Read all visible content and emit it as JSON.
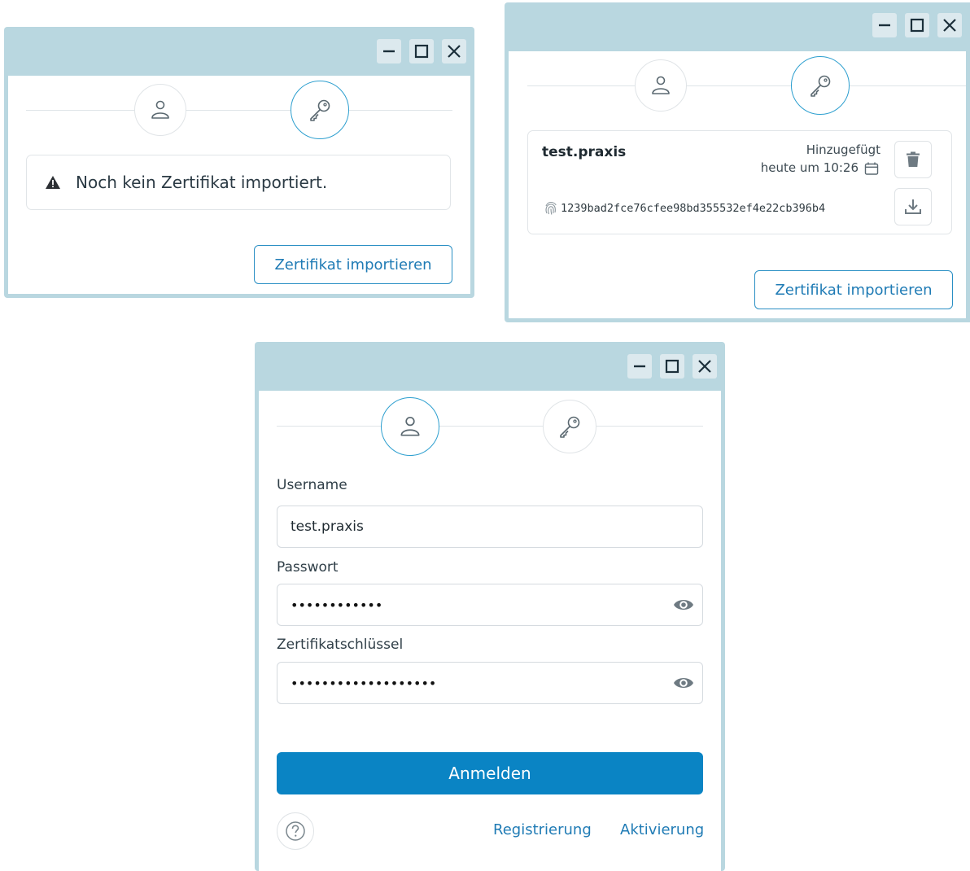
{
  "window_empty": {
    "controls": [
      "minimize-icon",
      "maximize-icon",
      "close-icon"
    ],
    "warning_icon": "warning-triangle-icon",
    "message": "Noch kein Zertifikat importiert.",
    "import_button": "Zertifikat importieren"
  },
  "window_certificate": {
    "controls": [
      "minimize-icon",
      "maximize-icon",
      "close-icon"
    ],
    "certificate": {
      "name": "test.praxis",
      "added_label": "Hinzugefügt",
      "added_time": "heute um 10:26",
      "fingerprint": "1239bad2fce76cfee98bd355532ef4e22cb396b4"
    },
    "import_button": "Zertifikat importieren"
  },
  "window_login": {
    "controls": [
      "minimize-icon",
      "maximize-icon",
      "close-icon"
    ],
    "username_label": "Username",
    "username_value": "test.praxis",
    "password_label": "Passwort",
    "password_value": "••••••••••••",
    "certkey_label": "Zertifikatschlüssel",
    "certkey_value": "•••••••••••••••••••",
    "login_button": "Anmelden",
    "register_link": "Registrierung",
    "activate_link": "Aktivierung",
    "help_icon": "question-circle-icon"
  },
  "colors": {
    "titlebar": "#b9d7e0",
    "accent": "#0a84c4",
    "active_step_border": "#2d9fcf"
  }
}
